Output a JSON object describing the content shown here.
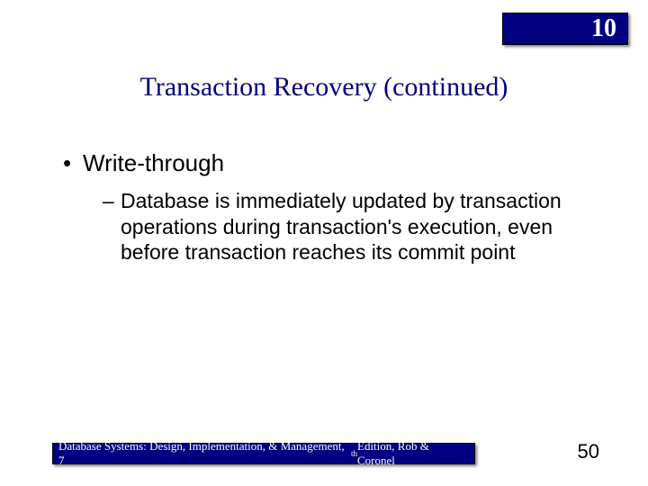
{
  "chapter_number": "10",
  "title": "Transaction Recovery (continued)",
  "bullets": {
    "l1": "Write-through",
    "l2": "Database is immediately updated by transaction operations during transaction's execution, even before transaction reaches its commit point"
  },
  "footer": {
    "text_before": "Database Systems: Design, Implementation, & Management, 7",
    "sup": "th",
    "text_after": " Edition, Rob & Coronel"
  },
  "page_number": "50"
}
